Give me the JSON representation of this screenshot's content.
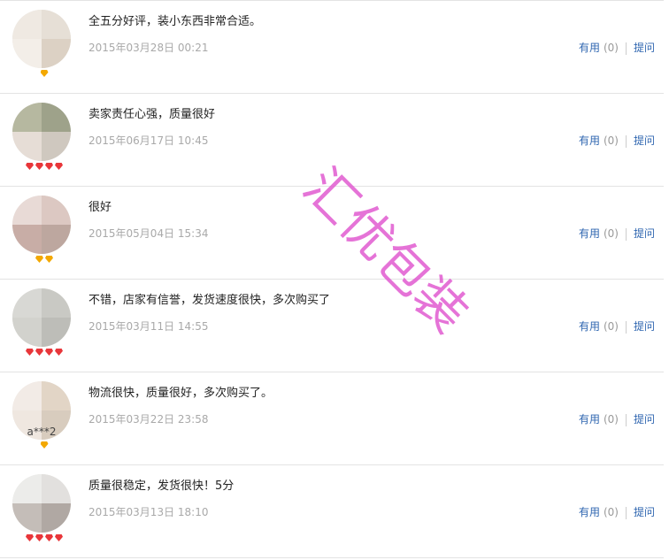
{
  "reviews": [
    {
      "text": "全五分好评，装小东西非常合适。",
      "date": "2015年03月28日 00:21",
      "username": "",
      "badge": {
        "kind": "gold",
        "count": 1
      },
      "useful_label": "有用",
      "useful_count": "(0)",
      "ask_label": "提问",
      "avatar_colors": [
        "#efe9e2",
        "#e6dfd6",
        "#f3eee8",
        "#dcd1c4"
      ]
    },
    {
      "text": "卖家责任心强，质量很好",
      "date": "2015年06月17日 10:45",
      "username": "",
      "badge": {
        "kind": "red",
        "count": 4
      },
      "useful_label": "有用",
      "useful_count": "(0)",
      "ask_label": "提问",
      "avatar_colors": [
        "#b6b8a0",
        "#9ea28a",
        "#e6ddd6",
        "#cfc8bf"
      ]
    },
    {
      "text": "很好",
      "date": "2015年05月04日 15:34",
      "username": "",
      "badge": {
        "kind": "gold",
        "count": 2
      },
      "useful_label": "有用",
      "useful_count": "(0)",
      "ask_label": "提问",
      "avatar_colors": [
        "#e8dad6",
        "#dcc8c2",
        "#c8ada6",
        "#bda79f"
      ]
    },
    {
      "text": "不错，店家有信誉，发货速度很快，多次购买了",
      "date": "2015年03月11日 14:55",
      "username": "",
      "badge": {
        "kind": "red",
        "count": 4
      },
      "useful_label": "有用",
      "useful_count": "(0)",
      "ask_label": "提问",
      "avatar_colors": [
        "#d8d8d4",
        "#c9c9c4",
        "#d2d2cd",
        "#bdbdb8"
      ]
    },
    {
      "text": "物流很快，质量很好，多次购买了。",
      "date": "2015年03月22日 23:58",
      "username": "a***2",
      "badge": {
        "kind": "gold",
        "count": 1
      },
      "useful_label": "有用",
      "useful_count": "(0)",
      "ask_label": "提问",
      "avatar_colors": [
        "#f2ebe6",
        "#e2d5c6",
        "#efe7e0",
        "#d8ccbe"
      ]
    },
    {
      "text": "质量很稳定，发货很快！5分",
      "date": "2015年03月13日 18:10",
      "username": "",
      "badge": {
        "kind": "red",
        "count": 4
      },
      "useful_label": "有用",
      "useful_count": "(0)",
      "ask_label": "提问",
      "avatar_colors": [
        "#ececea",
        "#e2e0de",
        "#c4bdb8",
        "#b0a8a3"
      ]
    }
  ],
  "watermark": {
    "text": "汇优包装",
    "color": "#e05ad0"
  }
}
